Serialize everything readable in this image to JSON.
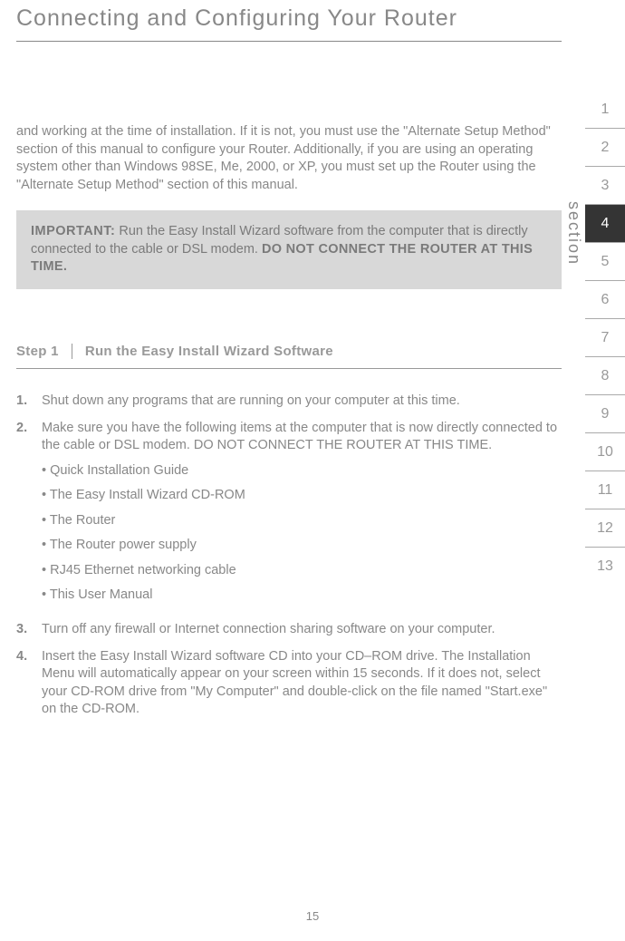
{
  "title": "Connecting and Configuring Your Router",
  "intro": "and working at the time of installation. If it is not, you must use the \"Alternate Setup Method\" section of this manual to configure your Router. Additionally, if you are using an operating system other than Windows 98SE, Me, 2000, or XP, you must set up the Router using the \"Alternate Setup Method\" section of this manual.",
  "important": {
    "label": "IMPORTANT:",
    "text": " Run the Easy Install Wizard software from the computer that is directly connected to the cable or DSL modem. ",
    "donot": "DO NOT CONNECT THE ROUTER AT THIS TIME."
  },
  "step_header": {
    "label": "Step 1",
    "title": "Run the Easy Install Wizard Software"
  },
  "steps": [
    {
      "num": "1.",
      "text": "Shut down any programs that are running on your computer at this time."
    },
    {
      "num": "2.",
      "text": "Make sure you have the following items at the computer that is now directly connected to the cable or DSL modem. DO NOT CONNECT THE ROUTER AT THIS TIME.",
      "bullets": [
        "• Quick Installation Guide",
        "• The Easy Install Wizard CD-ROM",
        "• The Router",
        "• The Router power supply",
        "• RJ45 Ethernet networking cable",
        "• This User Manual"
      ]
    },
    {
      "num": "3.",
      "text": "Turn off any firewall or Internet connection sharing software on your computer."
    },
    {
      "num": "4.",
      "text": "Insert the Easy Install Wizard software CD into your CD–ROM drive. The Installation Menu will automatically appear on your screen within 15 seconds. If it does not, select your CD-ROM drive from \"My Computer\" and double-click on the file named \"Start.exe\" on the CD-ROM."
    }
  ],
  "section_label": "section",
  "tabs": [
    "1",
    "2",
    "3",
    "4",
    "5",
    "6",
    "7",
    "8",
    "9",
    "10",
    "11",
    "12",
    "13"
  ],
  "active_tab": "4",
  "page_number": "15"
}
